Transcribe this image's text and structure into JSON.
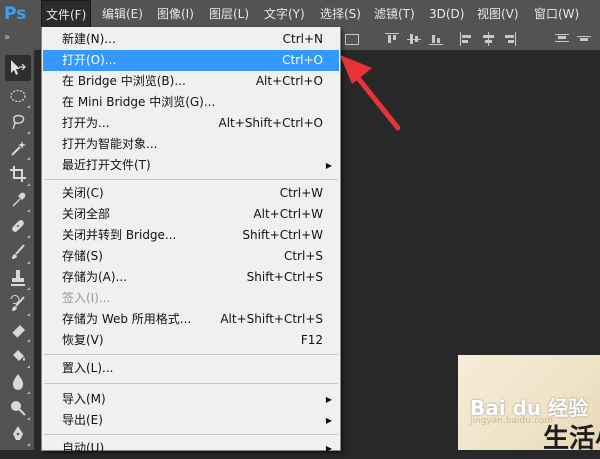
{
  "app": {
    "logo": "Ps"
  },
  "menubar": {
    "items": [
      {
        "label": "文件(F)",
        "active": true
      },
      {
        "label": "编辑(E)"
      },
      {
        "label": "图像(I)"
      },
      {
        "label": "图层(L)"
      },
      {
        "label": "文字(Y)"
      },
      {
        "label": "选择(S)"
      },
      {
        "label": "滤镜(T)"
      },
      {
        "label": "3D(D)"
      },
      {
        "label": "视图(V)"
      },
      {
        "label": "窗口(W)"
      }
    ]
  },
  "options_bar": {
    "expand_arrows": "»"
  },
  "file_menu": {
    "groups": [
      [
        {
          "label": "新建(N)...",
          "shortcut": "Ctrl+N"
        },
        {
          "label": "打开(O)...",
          "shortcut": "Ctrl+O",
          "highlighted": true
        },
        {
          "label": "在 Bridge 中浏览(B)...",
          "shortcut": "Alt+Ctrl+O"
        },
        {
          "label": "在 Mini Bridge 中浏览(G)...",
          "shortcut": ""
        },
        {
          "label": "打开为...",
          "shortcut": "Alt+Shift+Ctrl+O"
        },
        {
          "label": "打开为智能对象...",
          "shortcut": ""
        },
        {
          "label": "最近打开文件(T)",
          "shortcut": "",
          "submenu": true
        }
      ],
      [
        {
          "label": "关闭(C)",
          "shortcut": "Ctrl+W"
        },
        {
          "label": "关闭全部",
          "shortcut": "Alt+Ctrl+W"
        },
        {
          "label": "关闭并转到 Bridge...",
          "shortcut": "Shift+Ctrl+W"
        },
        {
          "label": "存储(S)",
          "shortcut": "Ctrl+S"
        },
        {
          "label": "存储为(A)...",
          "shortcut": "Shift+Ctrl+S"
        },
        {
          "label": "签入(I)...",
          "shortcut": "",
          "disabled": true
        },
        {
          "label": "存储为 Web 所用格式...",
          "shortcut": "Alt+Shift+Ctrl+S"
        },
        {
          "label": "恢复(V)",
          "shortcut": "F12"
        }
      ],
      [
        {
          "label": "置入(L)...",
          "shortcut": ""
        }
      ],
      [
        {
          "label": "导入(M)",
          "shortcut": "",
          "submenu": true
        },
        {
          "label": "导出(E)",
          "shortcut": "",
          "submenu": true
        }
      ],
      [
        {
          "label": "自动(U)",
          "shortcut": "",
          "submenu": true
        }
      ]
    ]
  },
  "watermark": {
    "logo": "Bai du 经验",
    "url": "jingyan.baidu.com",
    "text": "生活小"
  },
  "colors": {
    "highlight": "#3399ff",
    "annotation_arrow": "#e8323a",
    "logo_blue": "#3fa0ea"
  }
}
